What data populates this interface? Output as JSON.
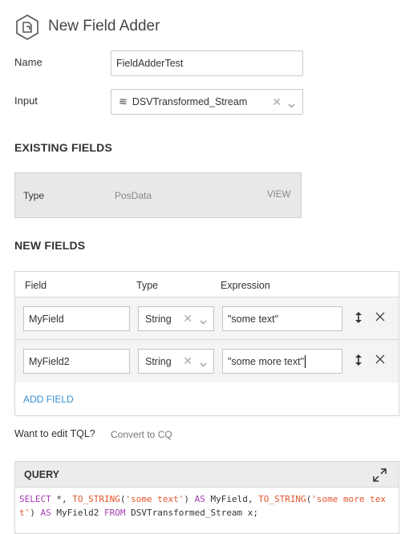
{
  "header": {
    "title": "New Field Adder",
    "icon": "component-icon"
  },
  "form": {
    "name_label": "Name",
    "name_value": "FieldAdderTest",
    "input_label": "Input",
    "input_value": "DSVTransformed_Stream",
    "input_icon": "stream-icon"
  },
  "existing_fields": {
    "title": "EXISTING FIELDS",
    "type_label": "Type",
    "type_value": "PosData",
    "view_label": "VIEW"
  },
  "new_fields": {
    "title": "NEW FIELDS",
    "columns": [
      "Field",
      "Type",
      "Expression"
    ],
    "rows": [
      {
        "field": "MyField",
        "type": "String",
        "expression": "\"some text\""
      },
      {
        "field": "MyField2",
        "type": "String",
        "expression": "\"some more text\""
      }
    ],
    "add_label": "ADD FIELD"
  },
  "tql": {
    "question": "Want to edit TQL?",
    "convert_label": "Convert to CQ"
  },
  "query": {
    "title": "QUERY",
    "tokens": [
      {
        "t": "SELECT",
        "c": "kw"
      },
      {
        "t": " *, ",
        "c": ""
      },
      {
        "t": "TO_STRING",
        "c": "fn"
      },
      {
        "t": "(",
        "c": ""
      },
      {
        "t": "'some text'",
        "c": "str"
      },
      {
        "t": ") ",
        "c": ""
      },
      {
        "t": "AS",
        "c": "kw"
      },
      {
        "t": " MyField, ",
        "c": ""
      },
      {
        "t": "TO_STRING",
        "c": "fn"
      },
      {
        "t": "(",
        "c": ""
      },
      {
        "t": "'some more text'",
        "c": "str"
      },
      {
        "t": ") ",
        "c": ""
      },
      {
        "t": "AS",
        "c": "kw"
      },
      {
        "t": " MyField2 ",
        "c": ""
      },
      {
        "t": "FROM",
        "c": "kw"
      },
      {
        "t": " DSVTransformed_Stream x;",
        "c": ""
      }
    ]
  },
  "colors": {
    "accent_link": "#3a8fd0",
    "keyword": "#a23bb0",
    "string": "#e2552e"
  }
}
